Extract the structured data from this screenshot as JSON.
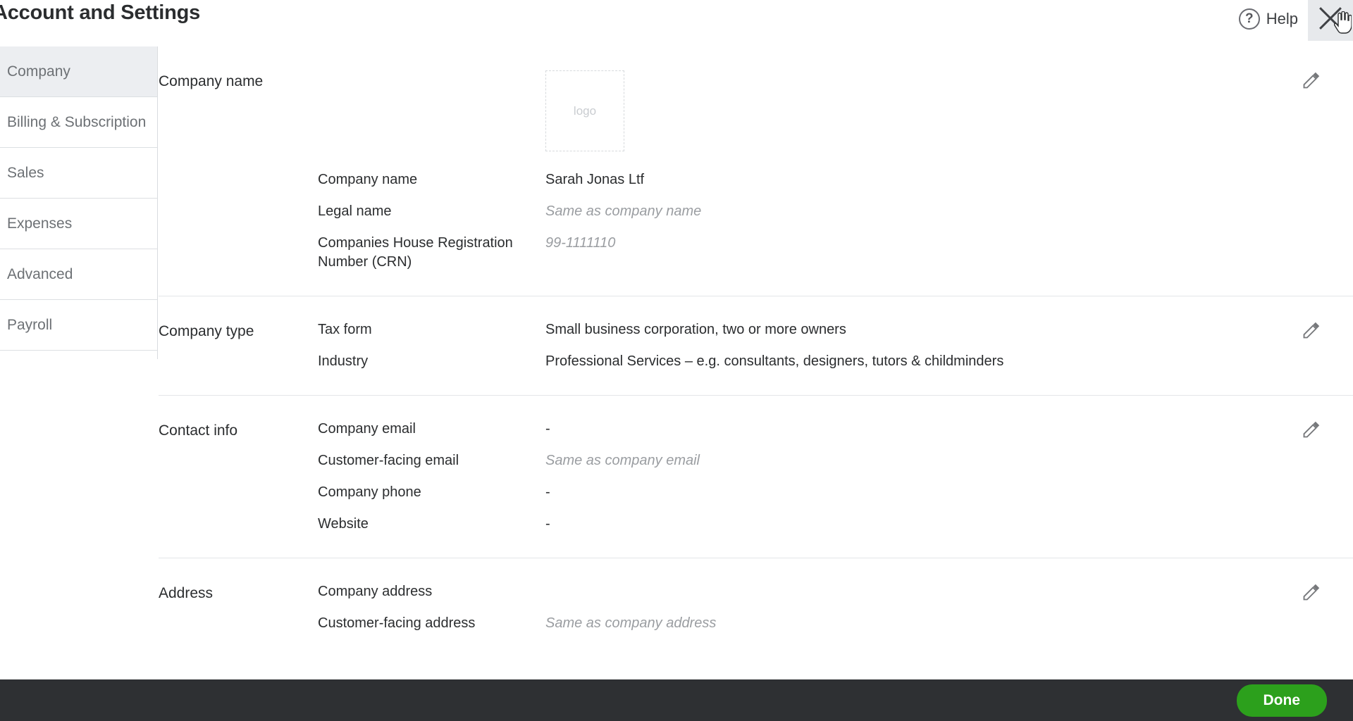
{
  "header": {
    "title": "Account and Settings",
    "help_label": "Help",
    "help_icon": "question-circle-icon",
    "close_icon": "close-x-icon"
  },
  "sidebar": {
    "items": [
      {
        "label": "Company",
        "active": true
      },
      {
        "label": "Billing & Subscription",
        "active": false
      },
      {
        "label": "Sales",
        "active": false
      },
      {
        "label": "Expenses",
        "active": false
      },
      {
        "label": "Advanced",
        "active": false
      },
      {
        "label": "Payroll",
        "active": false
      }
    ]
  },
  "sections": [
    {
      "title": "Company name",
      "logo_placeholder": "logo",
      "edit_icon": "pencil-icon",
      "fields": [
        {
          "label": "Company name",
          "value": "Sarah Jonas Ltf",
          "muted": false
        },
        {
          "label": "Legal name",
          "value": "Same as company name",
          "muted": true
        },
        {
          "label": "Companies House Registration Number (CRN)",
          "value": "99-1111110",
          "muted": true
        }
      ]
    },
    {
      "title": "Company type",
      "edit_icon": "pencil-icon",
      "fields": [
        {
          "label": "Tax form",
          "value": "Small business corporation, two or more owners",
          "muted": false
        },
        {
          "label": "Industry",
          "value": "Professional Services – e.g. consultants, designers, tutors & childminders",
          "muted": false
        }
      ]
    },
    {
      "title": "Contact info",
      "edit_icon": "pencil-icon",
      "fields": [
        {
          "label": "Company email",
          "value": "-",
          "muted": false
        },
        {
          "label": "Customer-facing email",
          "value": "Same as company email",
          "muted": true
        },
        {
          "label": "Company phone",
          "value": "-",
          "muted": false
        },
        {
          "label": "Website",
          "value": "-",
          "muted": false
        }
      ]
    },
    {
      "title": "Address",
      "edit_icon": "pencil-icon",
      "fields": [
        {
          "label": "Company address",
          "value": "",
          "muted": false
        },
        {
          "label": "Customer-facing address",
          "value": "Same as company address",
          "muted": true
        }
      ]
    }
  ],
  "footer": {
    "done_label": "Done",
    "done_color": "#2ca01c",
    "background": "#2e3033"
  }
}
